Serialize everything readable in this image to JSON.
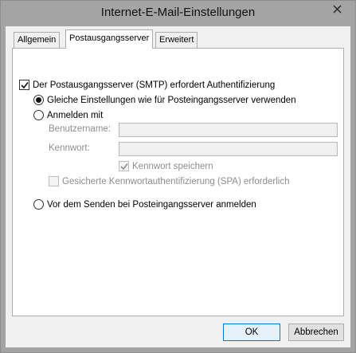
{
  "window": {
    "title": "Internet-E-Mail-Einstellungen"
  },
  "tabs": [
    {
      "label": "Allgemein",
      "active": false
    },
    {
      "label": "Postausgangsserver",
      "active": true
    },
    {
      "label": "Erweitert",
      "active": false
    }
  ],
  "outgoing": {
    "smtp_auth": {
      "label": "Der Postausgangsserver (SMTP) erfordert Authentifizierung",
      "checked": true
    },
    "use_same_settings": {
      "label": "Gleiche Einstellungen wie für Posteingangsserver verwenden",
      "selected": true
    },
    "log_on_using": {
      "label": "Anmelden mit",
      "selected": false
    },
    "username": {
      "label": "Benutzername:",
      "value": ""
    },
    "password": {
      "label": "Kennwort:",
      "value": ""
    },
    "remember_password": {
      "label": "Kennwort speichern",
      "checked": true,
      "enabled": false
    },
    "spa": {
      "label": "Gesicherte Kennwortauthentifizierung (SPA) erforderlich",
      "checked": false,
      "enabled": false
    },
    "log_on_incoming_first": {
      "label": "Vor dem Senden bei Posteingangsserver anmelden",
      "selected": false
    }
  },
  "buttons": {
    "ok": "OK",
    "cancel": "Abbrechen"
  }
}
